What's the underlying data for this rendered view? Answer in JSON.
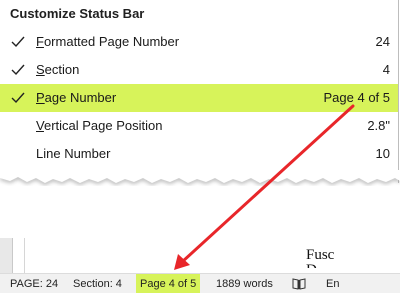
{
  "menu": {
    "title": "Customize Status Bar",
    "items": [
      {
        "label_underlined": "F",
        "label_rest": "ormatted Page Number",
        "value": "24",
        "checked": true,
        "highlighted": false
      },
      {
        "label_underlined": "S",
        "label_rest": "ection",
        "value": "4",
        "checked": true,
        "highlighted": false
      },
      {
        "label_underlined": "P",
        "label_rest": "age Number",
        "value": "Page 4 of 5",
        "checked": true,
        "highlighted": true
      },
      {
        "label_underlined": "V",
        "label_rest": "ertical Page Position",
        "value": "2.8\"",
        "checked": false,
        "highlighted": false
      },
      {
        "label_underlined": "",
        "label_rest": "Line Number",
        "value": "10",
        "checked": false,
        "highlighted": false
      }
    ]
  },
  "document": {
    "text_line1": "Fusc",
    "text_line2": "D"
  },
  "statusbar": {
    "page": "PAGE: 24",
    "section": "Section: 4",
    "page_number": "Page 4 of 5",
    "words": "1889 words",
    "language_abbrev": "En",
    "book_icon": "book-icon"
  },
  "colors": {
    "highlight": "#d7f35a",
    "arrow": "#e8262a"
  }
}
